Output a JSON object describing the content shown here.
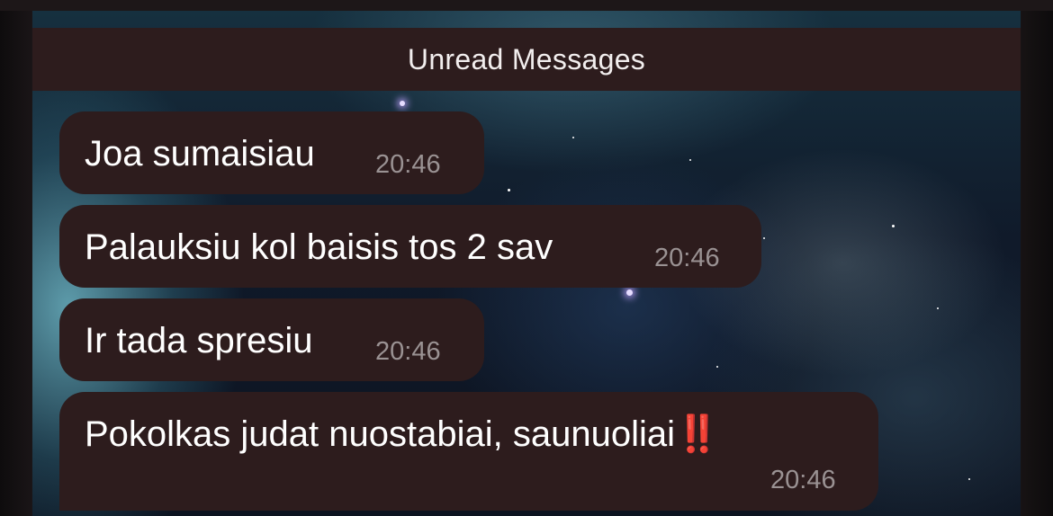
{
  "banner": {
    "label": "Unread Messages"
  },
  "messages": [
    {
      "text": "Joa sumaisiau",
      "time": "20:46"
    },
    {
      "text": "Palauksiu kol baisis tos 2 sav",
      "time": "20:46"
    },
    {
      "text": "Ir tada spresiu",
      "time": "20:46"
    },
    {
      "text": "Pokolkas judat nuostabiai, saunuoliai",
      "emoji": "‼️",
      "time": "20:46"
    }
  ],
  "colors": {
    "bubble": "#2d1c1d",
    "banner": "#2d1c1d",
    "text": "#ffffff",
    "time": "#9a9293",
    "emoji": "#e0332c"
  }
}
